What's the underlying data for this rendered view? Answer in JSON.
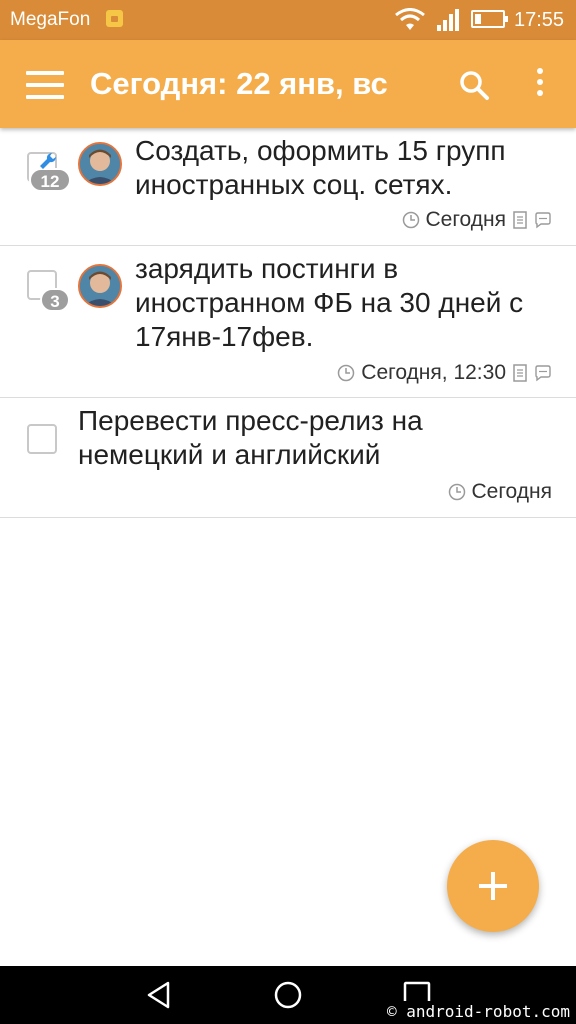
{
  "status_bar": {
    "carrier": "MegaFon",
    "time": "17:55"
  },
  "app_bar": {
    "title": "Сегодня: 22 янв, вс",
    "color": "#f4ad4a"
  },
  "tasks": [
    {
      "title_lines": [
        "Создать, оформить 15 групп",
        "иностранных соц. сетях."
      ],
      "badge_count": "12",
      "has_wrench": true,
      "has_avatar": true,
      "due": "Сегодня",
      "icons": [
        "clock-icon",
        "note-icon",
        "comment-icon"
      ]
    },
    {
      "title_lines": [
        "зарядить постинги в",
        "иностранном ФБ на 30 дней с",
        "17янв-17фев."
      ],
      "badge_count": "3",
      "has_wrench": false,
      "has_avatar": true,
      "due": "Сегодня, 12:30",
      "icons": [
        "clock-icon",
        "note-icon",
        "comment-icon"
      ]
    },
    {
      "title_lines": [
        "Перевести пресс-релиз на",
        "немецкий и английский"
      ],
      "badge_count": "",
      "has_wrench": false,
      "has_avatar": false,
      "due": "Сегодня",
      "icons": [
        "clock-icon"
      ]
    }
  ],
  "fab": {
    "icon": "plus-icon",
    "color": "#f4ad4a"
  },
  "nav_bar": {
    "buttons": [
      "back-icon",
      "home-icon",
      "recents-icon"
    ]
  },
  "watermark": "© android-robot.com"
}
